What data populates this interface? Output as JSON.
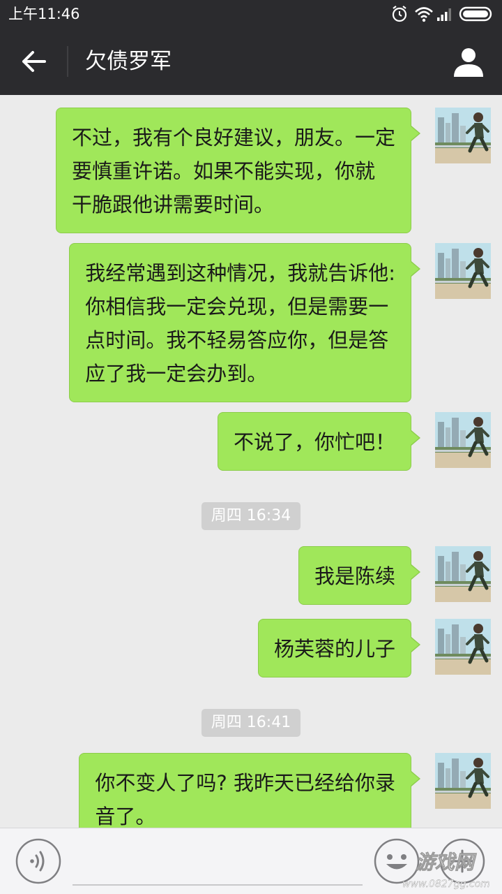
{
  "status_bar": {
    "time": "上午11:46",
    "icons": [
      "alarm-icon",
      "wifi-icon",
      "signal-icon",
      "battery-icon"
    ]
  },
  "header": {
    "back_icon": "arrow-left-icon",
    "title": "欠债罗军",
    "profile_icon": "person-icon"
  },
  "colors": {
    "bar_background": "#2b2b2e",
    "chat_background": "#ebebeb",
    "sent_bubble": "#a0e75a",
    "timestamp_badge": "#d0d0d0"
  },
  "messages": [
    {
      "lines": [
        "不过，我有个良好建议，朋友。一定",
        "要慎重许诺。如果不能实现，你就",
        "干脆跟他讲需要时间。"
      ]
    },
    {
      "lines": [
        "我经常遇到这种情况，我就告诉他:",
        "你相信我一定会兑现，但是需要一",
        "点时间。我不轻易答应你，但是答",
        "应了我一定会办到。"
      ]
    },
    {
      "lines": [
        "不说了，你忙吧！"
      ]
    },
    {
      "lines": [
        "我是陈续"
      ]
    },
    {
      "lines": [
        "杨芙蓉的儿子"
      ]
    },
    {
      "lines": [
        "你不变人了吗? 我昨天已经给你录",
        "音了。"
      ]
    }
  ],
  "timestamps": [
    "周四 16:34",
    "周四 16:41"
  ],
  "input_bar": {
    "voice_icon": "voice-icon",
    "emoji_icon": "smiley-icon",
    "plus_icon": "plus-icon"
  },
  "watermark": {
    "title": "游戏网",
    "url": "www.0827gg.com"
  }
}
